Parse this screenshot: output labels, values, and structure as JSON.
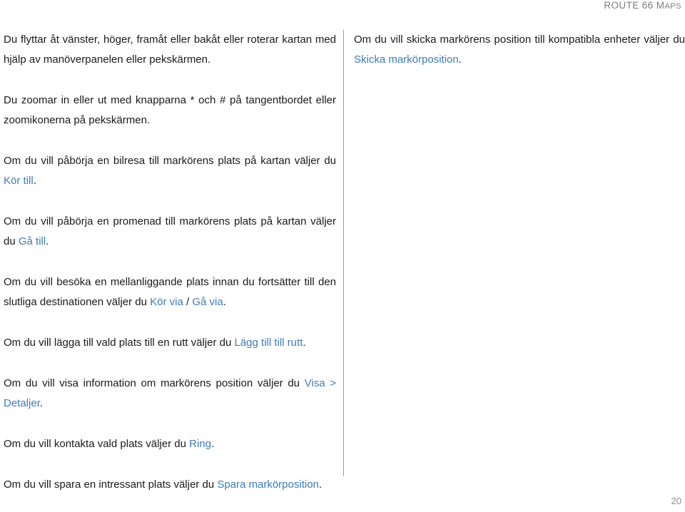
{
  "header": {
    "title_main": "ROUTE 66 ",
    "title_smallcaps_first": "M",
    "title_smallcaps_rest": "APS",
    "full_title": "ROUTE 66 MAPS"
  },
  "colors": {
    "link": "#3c7cb8",
    "body_text": "#1a1a1a",
    "header_text": "#7d7d7d",
    "divider": "#9a9a9a",
    "page_number": "#8a8a8a",
    "background": "#ffffff"
  },
  "left_column": {
    "paragraphs": [
      {
        "id": "move-map",
        "segments": [
          {
            "text": "Du flyttar åt vänster, höger, framåt eller bakåt eller roterar kartan med hjälp av manöverpanelen eller pekskärmen.",
            "link": false
          }
        ]
      },
      {
        "id": "zoom-map",
        "segments": [
          {
            "text": "Du zoomar in eller ut med knapparna * och # på tangentbordet eller zoomikonerna på pekskärmen.",
            "link": false
          }
        ]
      },
      {
        "id": "drive-to",
        "segments": [
          {
            "text": "Om du vill påbörja en bilresa till markörens plats på kartan väljer du ",
            "link": false
          },
          {
            "text": "Kör till",
            "link": true
          },
          {
            "text": ".",
            "link": false
          }
        ]
      },
      {
        "id": "walk-to",
        "segments": [
          {
            "text": "Om du vill påbörja en promenad till markörens plats på kartan väljer du ",
            "link": false
          },
          {
            "text": "Gå till",
            "link": true
          },
          {
            "text": ".",
            "link": false
          }
        ]
      },
      {
        "id": "via-point",
        "segments": [
          {
            "text": "Om du vill besöka en mellanliggande plats innan du fortsätter till den slutliga destinationen väljer du ",
            "link": false
          },
          {
            "text": "Kör via",
            "link": true
          },
          {
            "text": " / ",
            "link": false
          },
          {
            "text": "Gå via",
            "link": true
          },
          {
            "text": ".",
            "link": false
          }
        ]
      },
      {
        "id": "add-to-route",
        "segments": [
          {
            "text": "Om du vill lägga till vald plats till en rutt väljer du ",
            "link": false
          },
          {
            "text": "Lägg till till rutt",
            "link": true
          },
          {
            "text": ".",
            "link": false
          }
        ]
      },
      {
        "id": "show-details",
        "segments": [
          {
            "text": "Om du vill visa information om markörens position väljer du ",
            "link": false
          },
          {
            "text": "Visa > Detaljer",
            "link": true
          },
          {
            "text": ".",
            "link": false
          }
        ]
      },
      {
        "id": "call-place",
        "segments": [
          {
            "text": "Om du vill kontakta vald plats väljer du ",
            "link": false
          },
          {
            "text": "Ring",
            "link": true
          },
          {
            "text": ".",
            "link": false
          }
        ]
      },
      {
        "id": "save-marker",
        "segments": [
          {
            "text": "Om du vill spara en intressant plats väljer du ",
            "link": false
          },
          {
            "text": "Spara markörposition",
            "link": true
          },
          {
            "text": ".",
            "link": false
          }
        ]
      }
    ]
  },
  "right_column": {
    "paragraphs": [
      {
        "id": "send-marker-position",
        "segments": [
          {
            "text": "Om du vill skicka markörens position till kompatibla enheter väljer du ",
            "link": false
          },
          {
            "text": "Skicka markörposition",
            "link": true
          },
          {
            "text": ".",
            "link": false
          }
        ]
      }
    ]
  },
  "footer": {
    "page_number": "20"
  }
}
